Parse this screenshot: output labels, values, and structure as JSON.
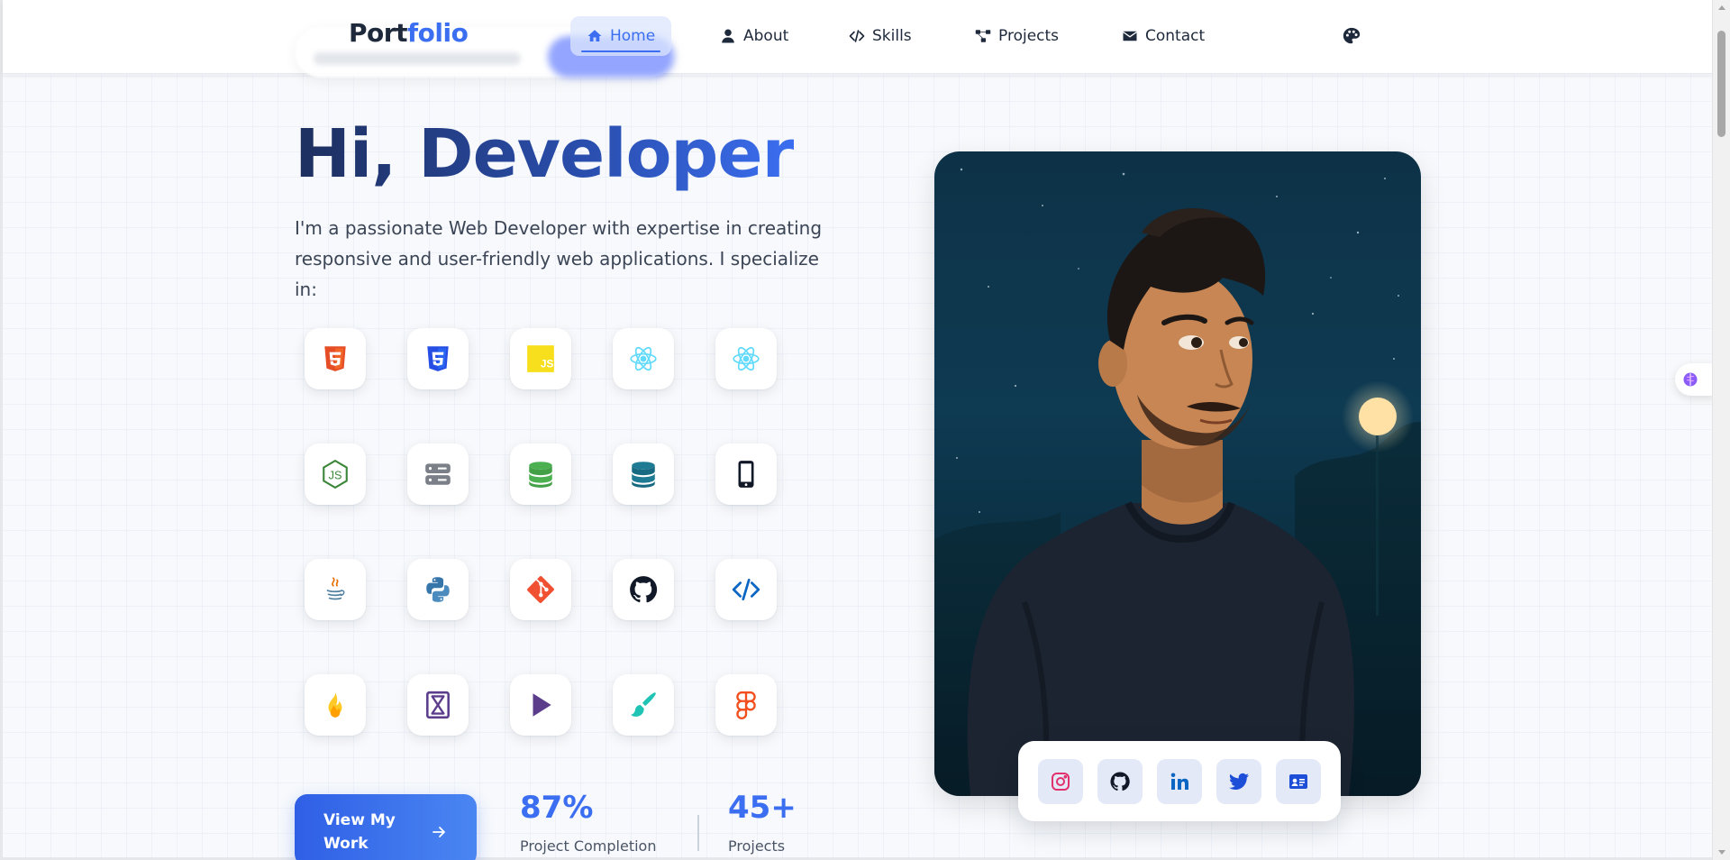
{
  "nav": {
    "logo_part1": "Port",
    "logo_part2": "folio",
    "items": [
      {
        "label": "Home",
        "icon": "home-icon",
        "active": true
      },
      {
        "label": "About",
        "icon": "user-icon",
        "active": false
      },
      {
        "label": "Skills",
        "icon": "code-icon",
        "active": false
      },
      {
        "label": "Projects",
        "icon": "project-diagram-icon",
        "active": false
      },
      {
        "label": "Contact",
        "icon": "envelope-icon",
        "active": false
      }
    ],
    "theme_icon": "palette-icon"
  },
  "hero": {
    "title": "Hi, Developer",
    "description": "I'm a passionate Web Developer with expertise in creating responsive and user-friendly web applications. I specialize in:",
    "tech_icons": [
      "html5-icon",
      "css3-icon",
      "javascript-icon",
      "react-icon",
      "react-native-icon",
      "nodejs-icon",
      "server-icon",
      "database-icon",
      "database-alt-icon",
      "mobile-icon",
      "java-icon",
      "python-icon",
      "git-icon",
      "github-icon",
      "code-icon",
      "firebase-icon",
      "hourglass-icon",
      "play-icon",
      "paintbrush-icon",
      "figma-icon"
    ],
    "cta_label": "View My Work",
    "stats": [
      {
        "value": "87%",
        "label": "Project Completion"
      },
      {
        "value": "45+",
        "label": "Projects"
      }
    ]
  },
  "social": {
    "links": [
      "instagram-icon",
      "github-icon",
      "linkedin-icon",
      "twitter-icon",
      "id-card-icon"
    ]
  },
  "colors": {
    "accent": "#3b6ef0",
    "title_dark": "#1e2f5e",
    "text": "#3b4556",
    "portrait_bg": "#0d3247"
  }
}
